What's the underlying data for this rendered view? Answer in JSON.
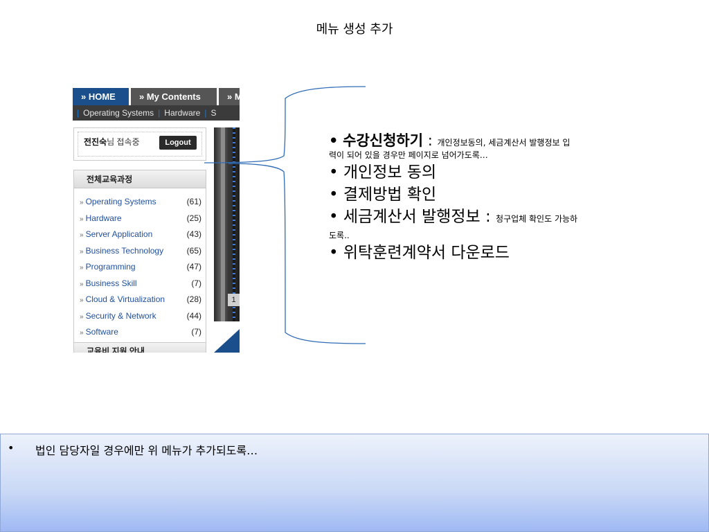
{
  "slide": {
    "title": "메뉴 생성 추가"
  },
  "site": {
    "tabs": [
      {
        "label": "» HOME"
      },
      {
        "label": "» My Contents"
      },
      {
        "label": "» M"
      }
    ],
    "subnav": [
      "Operating Systems",
      "Hardware",
      "S"
    ],
    "login": {
      "user": "전진숙",
      "suffix": "님 접속중",
      "logout_label": "Logout"
    },
    "courses": {
      "header": "전체교육과정",
      "bullet": "»",
      "items": [
        {
          "name": "Operating Systems",
          "count": "(61)"
        },
        {
          "name": "Hardware",
          "count": "(25)"
        },
        {
          "name": "Server Application",
          "count": "(43)"
        },
        {
          "name": "Business Technology",
          "count": "(65)"
        },
        {
          "name": "Programming",
          "count": "(47)"
        },
        {
          "name": "Business Skill",
          "count": "(7)"
        },
        {
          "name": "Cloud & Virtualization",
          "count": "(28)"
        },
        {
          "name": "Security & Network",
          "count": "(44)"
        },
        {
          "name": "Software",
          "count": "(7)"
        }
      ],
      "footer": "교육비 지원 안내"
    },
    "banner_tag": "1"
  },
  "callout": {
    "bullet": "•",
    "item1_title": "수강신청하기",
    "item1_colon": " : ",
    "item1_desc_a": "개인정보동의, 세금계산서 발행정보 입",
    "item1_desc_b": "력이 되어 있을 경우만 페이지로 넘어가도록…",
    "item2": "개인정보 동의",
    "item3": "결제방법 확인",
    "item4_title": "세금계산서 발행정보",
    "item4_colon": " : ",
    "item4_desc_a": "청구업체 확인도 가능하",
    "item4_desc_b": "도록..",
    "item5": "위탁훈련계약서 다운로드"
  },
  "note": {
    "bullet": "•",
    "text": "법인 담당자일 경우에만 위 메뉴가 추가되도록…"
  },
  "colors": {
    "nav_active": "#1b4f8c",
    "nav_inactive": "#555555",
    "link": "#1f4f9c",
    "note_gradient_bottom": "#9fb9f3",
    "brace_line": "#2f6cb5"
  }
}
